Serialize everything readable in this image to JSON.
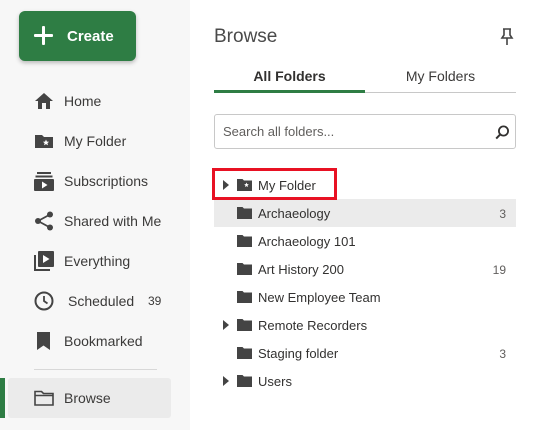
{
  "create_button": {
    "label": "Create"
  },
  "nav": {
    "items": [
      {
        "label": "Home",
        "icon": "home-icon"
      },
      {
        "label": "My Folder",
        "icon": "star-folder-icon"
      },
      {
        "label": "Subscriptions",
        "icon": "subscriptions-icon"
      },
      {
        "label": "Shared with Me",
        "icon": "share-icon"
      },
      {
        "label": "Everything",
        "icon": "play-library-icon"
      },
      {
        "label": "Scheduled",
        "icon": "clock-icon",
        "count": "39"
      },
      {
        "label": "Bookmarked",
        "icon": "bookmark-icon"
      },
      {
        "label": "Browse",
        "icon": "folder-outline-icon",
        "active": true
      }
    ],
    "accent_color": "#2e7d44"
  },
  "browse": {
    "title": "Browse",
    "tabs": [
      {
        "label": "All Folders",
        "active": true
      },
      {
        "label": "My Folders",
        "active": false
      }
    ],
    "search": {
      "placeholder": "Search all folders...",
      "value": ""
    },
    "folders": [
      {
        "label": "My Folder",
        "count": "",
        "expandable": true,
        "icon": "star-folder-icon",
        "highlighted": true
      },
      {
        "label": "Archaeology",
        "count": "3",
        "expandable": false,
        "icon": "folder-icon",
        "selected": true
      },
      {
        "label": "Archaeology 101",
        "count": "",
        "expandable": false,
        "icon": "folder-icon"
      },
      {
        "label": "Art History 200",
        "count": "19",
        "expandable": false,
        "icon": "folder-icon"
      },
      {
        "label": "New Employee Team",
        "count": "",
        "expandable": false,
        "icon": "folder-icon"
      },
      {
        "label": "Remote Recorders",
        "count": "",
        "expandable": true,
        "icon": "folder-icon"
      },
      {
        "label": "Staging folder",
        "count": "3",
        "expandable": false,
        "icon": "folder-icon"
      },
      {
        "label": "Users",
        "count": "",
        "expandable": true,
        "icon": "folder-icon"
      }
    ]
  }
}
